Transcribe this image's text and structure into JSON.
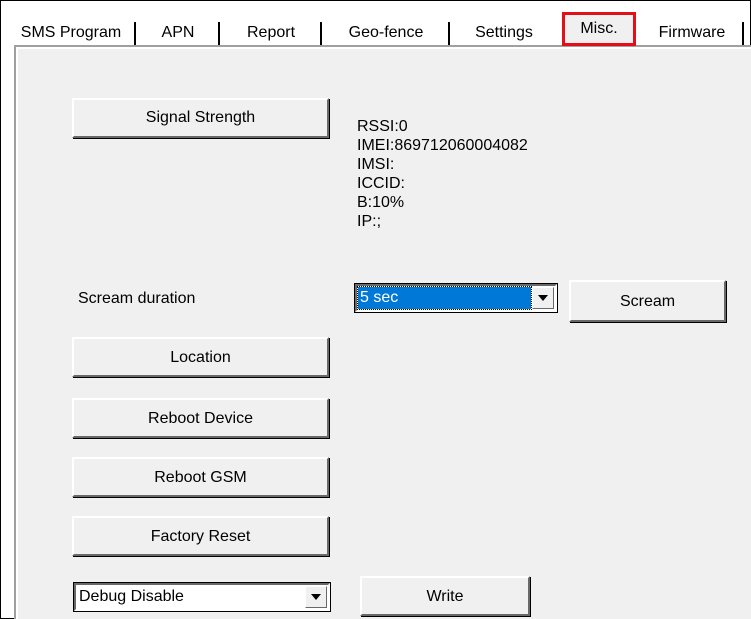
{
  "tabs": [
    {
      "label": "SMS Program",
      "active": false
    },
    {
      "label": "APN",
      "active": false
    },
    {
      "label": "Report",
      "active": false
    },
    {
      "label": "Geo-fence",
      "active": false
    },
    {
      "label": "Settings",
      "active": false
    },
    {
      "label": "Misc.",
      "active": true
    },
    {
      "label": "Firmware",
      "active": false
    }
  ],
  "highlight_color": "#e3101a",
  "selection_color": "#0078d7",
  "misc": {
    "signal_strength_button": "Signal Strength",
    "info": {
      "rssi": "RSSI:0",
      "imei": "IMEI:869712060004082",
      "imsi": "IMSI:",
      "iccid": "ICCID:",
      "battery": "B:10%",
      "ip": "IP:;"
    },
    "scream_duration_label": "Scream duration",
    "scream_duration_value": "5 sec",
    "scream_button": "Scream",
    "location_button": "Location",
    "reboot_device_button": "Reboot Device",
    "reboot_gsm_button": "Reboot GSM",
    "factory_reset_button": "Factory Reset",
    "debug_value": "Debug Disable",
    "write_button": "Write"
  },
  "icons": {
    "dropdown_arrow": "chevron-down-icon"
  }
}
